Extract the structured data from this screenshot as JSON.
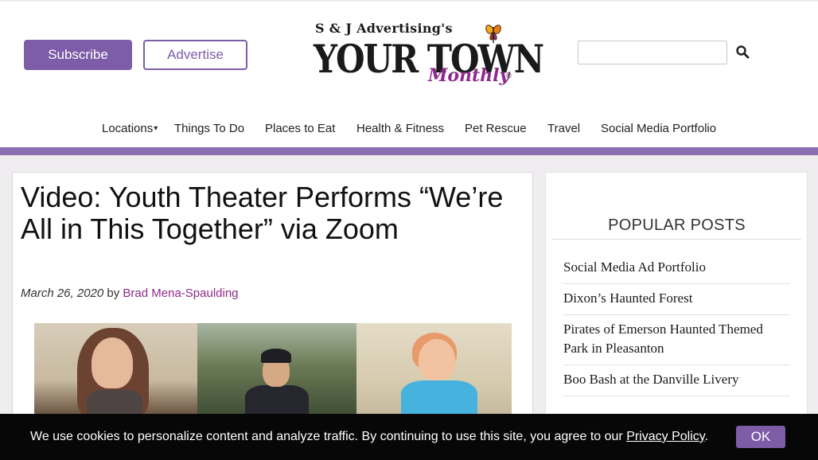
{
  "header": {
    "subscribe_label": "Subscribe",
    "advertise_label": "Advertise",
    "logo_top": "S & J Advertising's",
    "logo_main": "YOUR TOWN",
    "logo_sub": "Monthly",
    "logo_reg": "®",
    "search": {
      "value": "",
      "placeholder": ""
    }
  },
  "nav": {
    "items": [
      {
        "label": "Locations",
        "has_caret": true,
        "caret": "▾"
      },
      {
        "label": "Things To Do"
      },
      {
        "label": "Places to Eat"
      },
      {
        "label": "Health & Fitness"
      },
      {
        "label": "Pet Rescue"
      },
      {
        "label": "Travel"
      },
      {
        "label": "Social Media Portfolio"
      }
    ]
  },
  "article": {
    "title": "Video: Youth Theater Performs “We’re All in This Together” via Zoom",
    "date": "March 26, 2020",
    "by": "by",
    "author": "Brad Mena-Spaulding"
  },
  "sidebar": {
    "popular_title": "POPULAR POSTS",
    "posts": [
      "Social Media Ad Portfolio",
      "Dixon’s Haunted Forest",
      "Pirates of Emerson Haunted Themed Park in Pleasanton",
      "Boo Bash at the Danville Livery"
    ]
  },
  "cookie": {
    "text": "We use cookies to personalize content and analyze traffic. By continuing to use this site, you agree to our",
    "link": "Privacy Policy",
    "after": ".",
    "ok_label": "OK"
  },
  "colors": {
    "brand_purple": "#7d5ca8",
    "accent_magenta": "#8e2a8a",
    "bar_purple": "#8a6eb0",
    "cookie_bg": "#070707"
  }
}
